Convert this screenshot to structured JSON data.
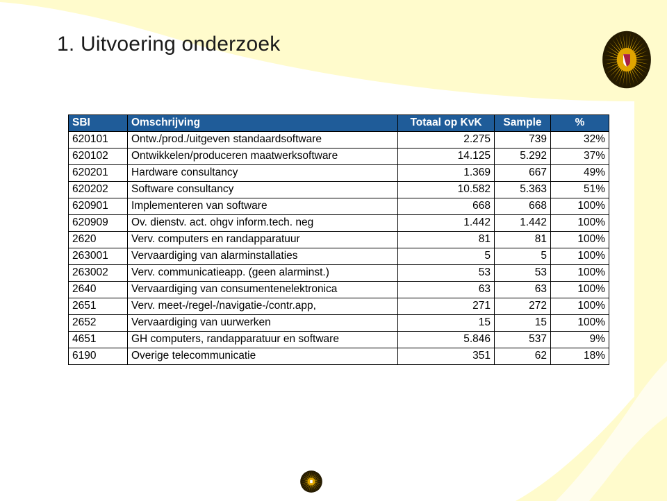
{
  "slide": {
    "title": "1. Uitvoering onderzoek",
    "logo_name": "utrecht-university-sun-logo",
    "accent_yellow": "#FFFBCC",
    "header_blue": "#1F5C99",
    "logo_gold": "#D4A017",
    "logo_dark": "#241A00",
    "logo_shield_red": "#A81F42",
    "text_color": "#1A1A1A"
  },
  "table": {
    "columns": [
      {
        "key": "sbi",
        "label": "SBI"
      },
      {
        "key": "desc",
        "label": "Omschrijving"
      },
      {
        "key": "total",
        "label": "Totaal op KvK"
      },
      {
        "key": "sample",
        "label": "Sample"
      },
      {
        "key": "pct",
        "label": "%"
      }
    ],
    "rows": [
      {
        "sbi": "620101",
        "desc": "Ontw./prod./uitgeven standaardsoftware",
        "total": "2.275",
        "sample": "739",
        "pct": "32%"
      },
      {
        "sbi": "620102",
        "desc": "Ontwikkelen/produceren maatwerksoftware",
        "total": "14.125",
        "sample": "5.292",
        "pct": "37%"
      },
      {
        "sbi": "620201",
        "desc": "Hardware consultancy",
        "total": "1.369",
        "sample": "667",
        "pct": "49%"
      },
      {
        "sbi": "620202",
        "desc": "Software consultancy",
        "total": "10.582",
        "sample": "5.363",
        "pct": "51%"
      },
      {
        "sbi": "620901",
        "desc": "Implementeren van software",
        "total": "668",
        "sample": "668",
        "pct": "100%"
      },
      {
        "sbi": "620909",
        "desc": "Ov. dienstv. act. ohgv inform.tech. neg",
        "total": "1.442",
        "sample": "1.442",
        "pct": "100%"
      },
      {
        "sbi": "2620",
        "desc": "Verv. computers en randapparatuur",
        "total": "81",
        "sample": "81",
        "pct": "100%"
      },
      {
        "sbi": "263001",
        "desc": "Vervaardiging van alarminstallaties",
        "total": "5",
        "sample": "5",
        "pct": "100%"
      },
      {
        "sbi": "263002",
        "desc": "Verv. communicatieapp. (geen alarminst.)",
        "total": "53",
        "sample": "53",
        "pct": "100%"
      },
      {
        "sbi": "2640",
        "desc": "Vervaardiging van consumentenelektronica",
        "total": "63",
        "sample": "63",
        "pct": "100%"
      },
      {
        "sbi": "2651",
        "desc": "Verv. meet-/regel-/navigatie-/contr.app,",
        "total": "271",
        "sample": "272",
        "pct": "100%"
      },
      {
        "sbi": "2652",
        "desc": "Vervaardiging van uurwerken",
        "total": "15",
        "sample": "15",
        "pct": "100%"
      },
      {
        "sbi": "4651",
        "desc": "GH computers, randapparatuur en software",
        "total": "5.846",
        "sample": "537",
        "pct": "9%"
      },
      {
        "sbi": "6190",
        "desc": "Overige telecommunicatie",
        "total": "351",
        "sample": "62",
        "pct": "18%"
      }
    ]
  }
}
